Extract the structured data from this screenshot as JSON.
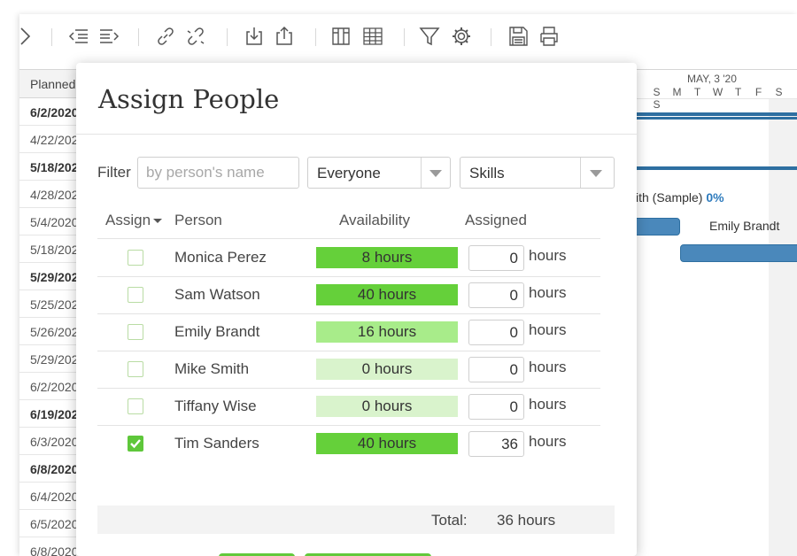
{
  "grid": {
    "header": "Planned",
    "rows": [
      {
        "date": "6/2/2020",
        "bold": true
      },
      {
        "date": "4/22/2020",
        "bold": false
      },
      {
        "date": "5/18/2020",
        "bold": true
      },
      {
        "date": "4/28/2020",
        "bold": false
      },
      {
        "date": "5/4/2020",
        "bold": false
      },
      {
        "date": "5/18/2020",
        "bold": false
      },
      {
        "date": "5/29/2020",
        "bold": true
      },
      {
        "date": "5/25/2020",
        "bold": false
      },
      {
        "date": "5/26/2020",
        "bold": false
      },
      {
        "date": "5/29/2020",
        "bold": false
      },
      {
        "date": "6/2/2020",
        "bold": false
      },
      {
        "date": "6/19/2020",
        "bold": true
      },
      {
        "date": "6/3/2020",
        "bold": false
      },
      {
        "date": "6/8/2020",
        "bold": true
      },
      {
        "date": "6/4/2020",
        "bold": false
      },
      {
        "date": "6/5/2020",
        "bold": false
      },
      {
        "date": "6/8/2020",
        "bold": false
      }
    ]
  },
  "gantt": {
    "week_label": "MAY, 3 '20",
    "days": [
      "S",
      "M",
      "T",
      "W",
      "T",
      "F",
      "S",
      "S"
    ],
    "task_label": "ith (Sample)",
    "task_pct": "0%",
    "assignee_label": "Emily Brandt",
    "bar_color": "#2e6fa1"
  },
  "toolbar": {
    "icons": [
      "chevron-right-icon",
      "outdent-icon",
      "indent-icon",
      "link-icon",
      "unlink-icon",
      "import-icon",
      "export-icon",
      "columns-icon",
      "table-icon",
      "filter-icon",
      "gear-icon",
      "save-icon",
      "print-icon"
    ]
  },
  "modal": {
    "title": "Assign People",
    "filter": {
      "label": "Filter",
      "placeholder": "by person's name",
      "group_value": "Everyone",
      "skills_value": "Skills"
    },
    "columns": {
      "assign": "Assign",
      "person": "Person",
      "availability": "Availability",
      "assigned": "Assigned"
    },
    "unit": "hours",
    "people": [
      {
        "name": "Monica Perez",
        "availability": "8 hours",
        "level": "full",
        "assigned": "0",
        "checked": false
      },
      {
        "name": "Sam Watson",
        "availability": "40 hours",
        "level": "full",
        "assigned": "0",
        "checked": false
      },
      {
        "name": "Emily Brandt",
        "availability": "16 hours",
        "level": "mid",
        "assigned": "0",
        "checked": false
      },
      {
        "name": "Mike Smith",
        "availability": "0 hours",
        "level": "empty",
        "assigned": "0",
        "checked": false
      },
      {
        "name": "Tiffany Wise",
        "availability": "0 hours",
        "level": "empty",
        "assigned": "0",
        "checked": false
      },
      {
        "name": "Tim Sanders",
        "availability": "40 hours",
        "level": "full",
        "assigned": "36",
        "checked": true
      }
    ],
    "total_label": "Total:",
    "total_value": "36 hours",
    "colors": {
      "available_full": "#65d03a",
      "available_partial": "#a8ec8a",
      "available_none": "#d9f3cc",
      "check": "#5ec73a"
    }
  }
}
